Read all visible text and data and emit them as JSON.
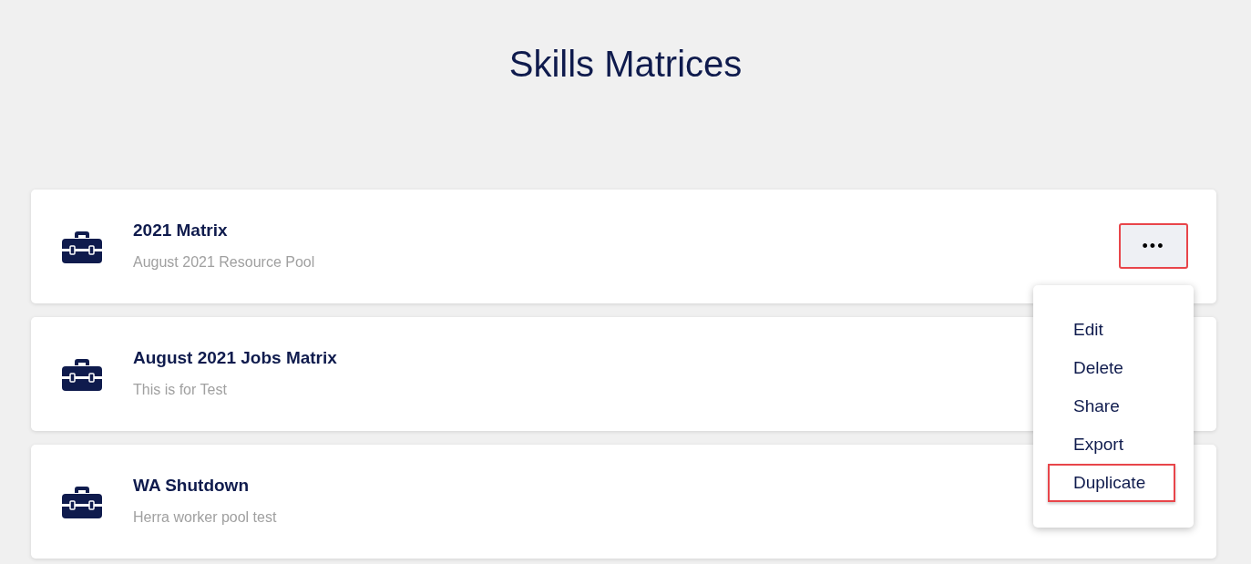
{
  "page_title": "Skills Matrices",
  "matrices": [
    {
      "name": "2021 Matrix",
      "description": "August 2021 Resource Pool",
      "menu_open": true
    },
    {
      "name": "August 2021 Jobs Matrix",
      "description": "This is for Test",
      "menu_open": false
    },
    {
      "name": "WA Shutdown",
      "description": "Herra worker pool test",
      "menu_open": false
    }
  ],
  "more_button": {
    "label": "•••",
    "highlighted": true
  },
  "menu": [
    {
      "label": "Edit",
      "highlighted": false
    },
    {
      "label": "Delete",
      "highlighted": false
    },
    {
      "label": "Share",
      "highlighted": false
    },
    {
      "label": "Export",
      "highlighted": false
    },
    {
      "label": "Duplicate",
      "highlighted": true
    }
  ]
}
